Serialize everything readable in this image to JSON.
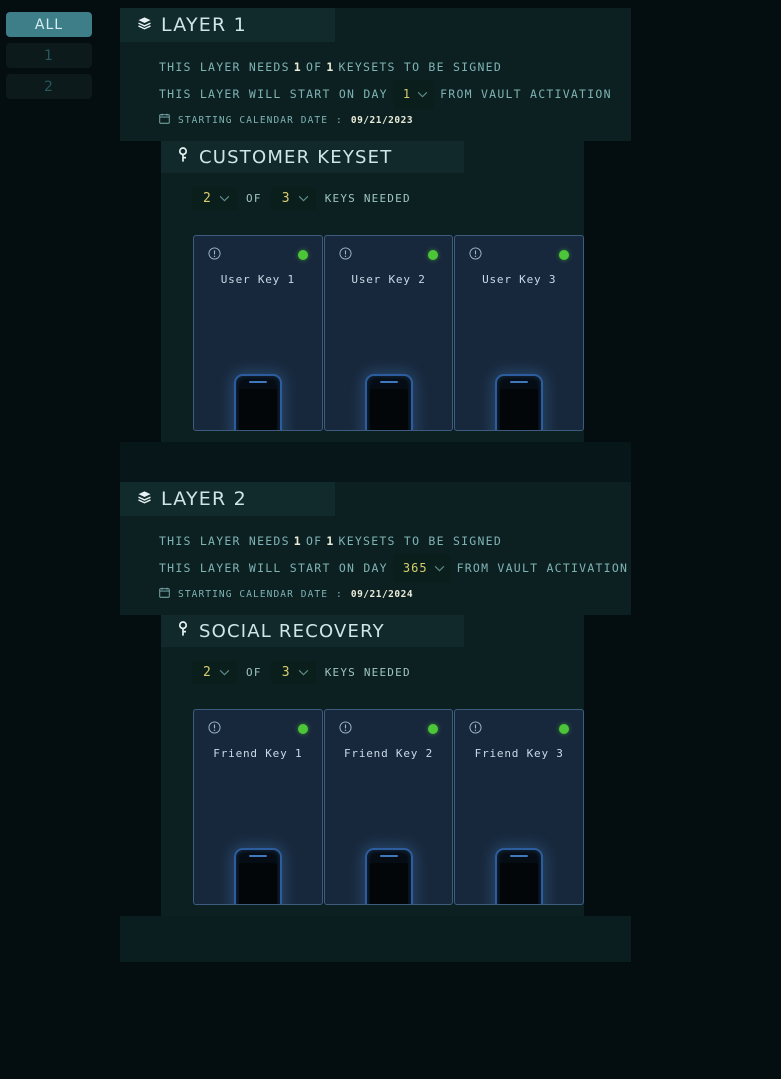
{
  "sidebar": {
    "items": [
      {
        "label": "ALL",
        "active": true
      },
      {
        "label": "1",
        "active": false
      },
      {
        "label": "2",
        "active": false
      }
    ]
  },
  "layers": [
    {
      "title": "LAYER 1",
      "needs_prefix": "THIS LAYER NEEDS",
      "needs_count": "1",
      "needs_of": "OF",
      "needs_total": "1",
      "needs_suffix": "KEYSETS TO BE SIGNED",
      "start_prefix": "THIS LAYER WILL START ON DAY",
      "start_day": "1",
      "start_suffix": "FROM VAULT ACTIVATION",
      "calendar_label": "STARTING CALENDAR DATE",
      "calendar_sep": ":",
      "calendar_date": "09/21/2023",
      "keyset": {
        "title": "CUSTOMER KEYSET",
        "threshold": "2",
        "of_label": "OF",
        "total": "3",
        "keys_needed_label": "KEYS NEEDED",
        "cards": [
          {
            "label": "User Key 1",
            "status": "active"
          },
          {
            "label": "User Key 2",
            "status": "active"
          },
          {
            "label": "User Key 3",
            "status": "active"
          }
        ]
      }
    },
    {
      "title": "LAYER 2",
      "needs_prefix": "THIS LAYER NEEDS",
      "needs_count": "1",
      "needs_of": "OF",
      "needs_total": "1",
      "needs_suffix": "KEYSETS TO BE SIGNED",
      "start_prefix": "THIS LAYER WILL START ON DAY",
      "start_day": "365",
      "start_suffix": "FROM VAULT ACTIVATION",
      "calendar_label": "STARTING CALENDAR DATE",
      "calendar_sep": ":",
      "calendar_date": "09/21/2024",
      "keyset": {
        "title": "SOCIAL RECOVERY",
        "threshold": "2",
        "of_label": "OF",
        "total": "3",
        "keys_needed_label": "KEYS NEEDED",
        "cards": [
          {
            "label": "Friend Key 1",
            "status": "active"
          },
          {
            "label": "Friend Key 2",
            "status": "active"
          },
          {
            "label": "Friend Key 3",
            "status": "active"
          }
        ]
      }
    }
  ],
  "icons": {
    "layer_stack": "layers-stack-icon",
    "keyset": "key-icon",
    "calendar": "calendar-icon",
    "info": "info-circle-icon",
    "chevron": "chevron-down-icon",
    "status": "status-dot-icon",
    "device": "mobile-phone-icon"
  },
  "colors": {
    "page_bg": "#040d0f",
    "panel_bg": "#0c2022",
    "tab_bg": "#112a2c",
    "accent_teal": "#3d7e88",
    "text_teal": "#7fb3b3",
    "heading": "#cfe6e8",
    "value_yellow": "#d8cc6e",
    "status_green": "#4cc638",
    "card_bg": "#18283c",
    "card_border": "#3e5c7f",
    "device_blue": "#2c5d9e"
  }
}
